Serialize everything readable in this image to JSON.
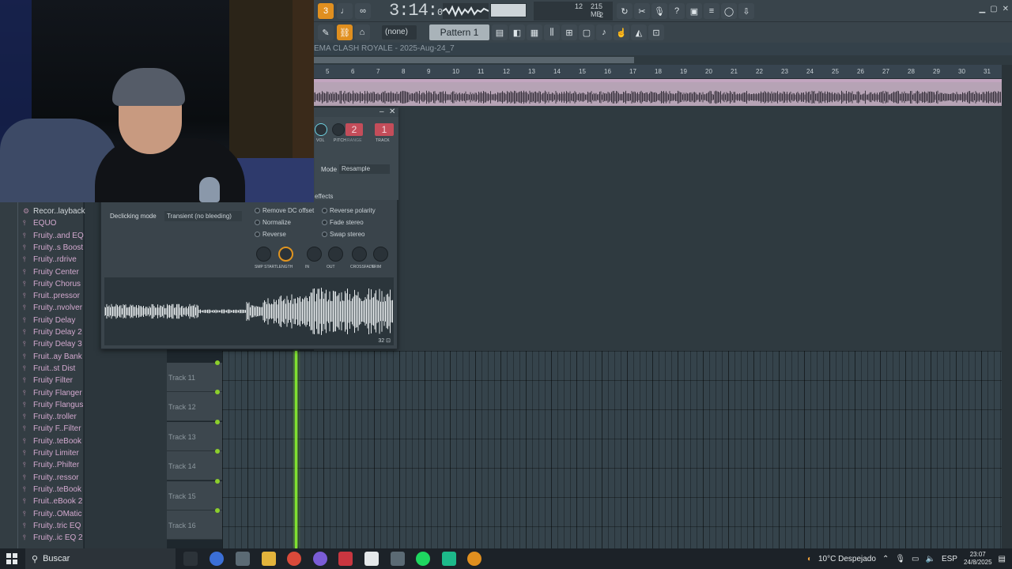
{
  "toolbar": {
    "time_main": "3:14:",
    "time_sub": "01",
    "cpu_a": "12",
    "cpu_b": "215 MB",
    "cpu_c": "2",
    "snap": "(none)",
    "pattern": "Pattern 1"
  },
  "playlist": {
    "title": "EMA CLASH ROYALE - 2025-Aug-24_7",
    "ruler": [
      "5",
      "6",
      "7",
      "8",
      "9",
      "10",
      "11",
      "12",
      "13",
      "14",
      "15",
      "16",
      "17",
      "18",
      "19",
      "20",
      "21",
      "22",
      "23",
      "24",
      "25",
      "26",
      "27",
      "28",
      "29",
      "30",
      "31"
    ],
    "tracks": [
      "Track 11",
      "Track 12",
      "Track 13",
      "Track 14",
      "Track 15",
      "Track 16"
    ]
  },
  "browser": {
    "items": [
      {
        "label": "Recor..layback",
        "icon": "gear-icon"
      },
      {
        "label": "EQUO",
        "icon": "plugin-icon"
      },
      {
        "label": "Fruity..and EQ",
        "icon": "plugin-icon"
      },
      {
        "label": "Fruity..s Boost",
        "icon": "plugin-icon"
      },
      {
        "label": "Fruity..rdrive",
        "icon": "plugin-icon"
      },
      {
        "label": "Fruity Center",
        "icon": "plugin-icon"
      },
      {
        "label": "Fruity Chorus",
        "icon": "plugin-icon"
      },
      {
        "label": "Fruit..pressor",
        "icon": "plugin-icon"
      },
      {
        "label": "Fruity..nvolver",
        "icon": "plugin-icon"
      },
      {
        "label": "Fruity Delay",
        "icon": "plugin-icon"
      },
      {
        "label": "Fruity Delay 2",
        "icon": "plugin-icon"
      },
      {
        "label": "Fruity Delay 3",
        "icon": "plugin-icon"
      },
      {
        "label": "Fruit..ay Bank",
        "icon": "plugin-icon"
      },
      {
        "label": "Fruit..st Dist",
        "icon": "plugin-icon"
      },
      {
        "label": "Fruity Filter",
        "icon": "plugin-icon"
      },
      {
        "label": "Fruity Flanger",
        "icon": "plugin-icon"
      },
      {
        "label": "Fruity Flangus",
        "icon": "plugin-icon"
      },
      {
        "label": "Fruity..troller",
        "icon": "plugin-icon"
      },
      {
        "label": "Fruity F..Filter",
        "icon": "plugin-icon"
      },
      {
        "label": "Fruity..teBook",
        "icon": "plugin-icon"
      },
      {
        "label": "Fruity Limiter",
        "icon": "plugin-icon"
      },
      {
        "label": "Fruity..Philter",
        "icon": "plugin-icon"
      },
      {
        "label": "Fruity..ressor",
        "icon": "plugin-icon"
      },
      {
        "label": "Fruity..teBook",
        "icon": "plugin-icon"
      },
      {
        "label": "Fruit..eBook 2",
        "icon": "plugin-icon"
      },
      {
        "label": "Fruity..OMatic",
        "icon": "plugin-icon"
      },
      {
        "label": "Fruity..tric EQ",
        "icon": "plugin-icon"
      },
      {
        "label": "Fruity..ic EQ 2",
        "icon": "plugin-icon"
      }
    ]
  },
  "sampler": {
    "pitch_label": "PITCH",
    "range_label": "RANGE",
    "track_label": "TRACK",
    "vol_label": "VOL",
    "range_value": "2",
    "track_value": "1",
    "mode_label": "Mode",
    "mode_value": "Resample",
    "effects_label": "effects",
    "declick_label": "Declicking mode",
    "declick_value": "Transient (no bleeding)",
    "options_left": [
      "Remove DC offset",
      "Normalize",
      "Reverse"
    ],
    "options_right": [
      "Reverse polarity",
      "Fade stereo",
      "Swap stereo"
    ],
    "knobs": [
      "SMP START",
      "LENGTH",
      "IN",
      "OUT",
      "CROSSFADE",
      "TRIM"
    ],
    "zoom": "32"
  },
  "taskbar": {
    "search": "Buscar",
    "weather": "10°C  Despejado",
    "lang": "ESP",
    "time": "23:07",
    "date": "24/8/2025"
  }
}
